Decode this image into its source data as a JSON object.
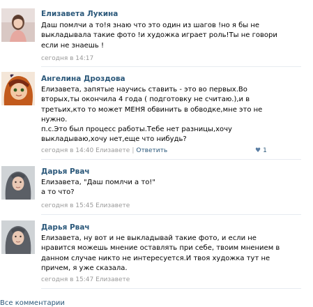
{
  "comments": [
    {
      "author": "Елизавета Лукина",
      "avatar_icon": "avatar-photo-girl",
      "lines": [
        "Даш помлчи а то!я знаю что это один из шагов !но я бы не",
        "выкладывала такие фото !и художка играет роль!Ты не говори",
        "если не знаешь !"
      ],
      "time": "сегодня в 14:17",
      "reply_to": "",
      "reply_label": "",
      "likes": ""
    },
    {
      "author": "Ангелина Дроздова",
      "avatar_icon": "avatar-cartoon-girl",
      "lines": [
        "Елизавета, запятые научись ставить - это во первых.Во",
        "вторых,ты окончила 4 года ( подготовку не считаю.),и в",
        "третьих,кто то может МЕНЯ обвинить в обводке,мне это не",
        "нужно.",
        "п.с.Это был процесс работы.Тебе нет разницы,хочу",
        "выкладываю,хочу нет,еще что нибудь?"
      ],
      "time": "сегодня в 14:40",
      "reply_to": "Елизавете",
      "reply_label": "Ответить",
      "likes": "1"
    },
    {
      "author": "Дарья Рвач",
      "avatar_icon": "avatar-photo-headscarf",
      "lines": [
        "Елизавета, \"Даш помлчи а то!\"",
        "а то что?"
      ],
      "time": "сегодня в 15:45",
      "reply_to": "Елизавете",
      "reply_label": "",
      "likes": ""
    },
    {
      "author": "Дарья Рвач",
      "avatar_icon": "avatar-photo-headscarf",
      "lines": [
        "Елизавета, ну вот и не выкладывай такие фото, и если не",
        "нравится можешь мнение оставлять при себе, твоим мнением в",
        "данном случае никто не интересуется.И твоя художка тут не",
        "причем, я уже сказала."
      ],
      "time": "сегодня в 15:47",
      "reply_to": "Елизавете",
      "reply_label": "",
      "likes": ""
    }
  ],
  "footer": {
    "link_label": "Все комментарии"
  },
  "colors": {
    "link": "#2b587a",
    "meta": "#999999",
    "divider": "#e7ebf0"
  }
}
